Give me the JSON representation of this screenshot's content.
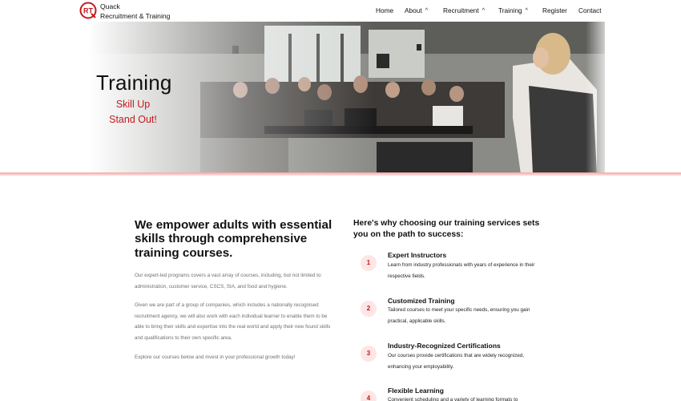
{
  "brand": {
    "logo_text": "RT",
    "line1": "Quack",
    "line2": "Recruitment & Training",
    "accent": "#c01a1e"
  },
  "nav": {
    "home": "Home",
    "about": "About",
    "recruitment": "Recruitment",
    "training": "Training",
    "register": "Register",
    "contact": "Contact",
    "chevron": "^"
  },
  "hero": {
    "title": "Training",
    "subtitle_line1": "Skill Up",
    "subtitle_line2": "Stand Out!"
  },
  "intro": {
    "heading": "We empower adults with essential skills through comprehensive training courses.",
    "paragraphs": [
      "Our expert-led programs covers a vast array of courses, including, but not limited to: administration, customer service, CSCS, SIA, and food and hygiene.",
      "Given we are part of a group of companies, which includes a nationally recognised recruitment agency, we will also work with each individual learner to enable them to be able to bring their skills and expertise into the real world and apply their new found skills and qualifications to their own specific area.",
      "Explore our courses below and invest in your professional growth today!"
    ]
  },
  "why": {
    "heading": "Here's why choosing our training services sets you on the path to success:",
    "features": [
      {
        "number": "1",
        "title": "Expert Instructors",
        "desc": "Learn from industry professionals with years of experience in their respective fields."
      },
      {
        "number": "2",
        "title": "Customized Training",
        "desc": "Tailored courses to meet your specific needs, ensuring you gain practical, applicable skills."
      },
      {
        "number": "3",
        "title": "Industry-Recognized Certifications",
        "desc": "Our courses provide certifications that are widely recognized, enhancing your employability."
      },
      {
        "number": "4",
        "title": "Flexible Learning",
        "desc": "Convenient scheduling and a variety of learning formats to"
      }
    ]
  }
}
